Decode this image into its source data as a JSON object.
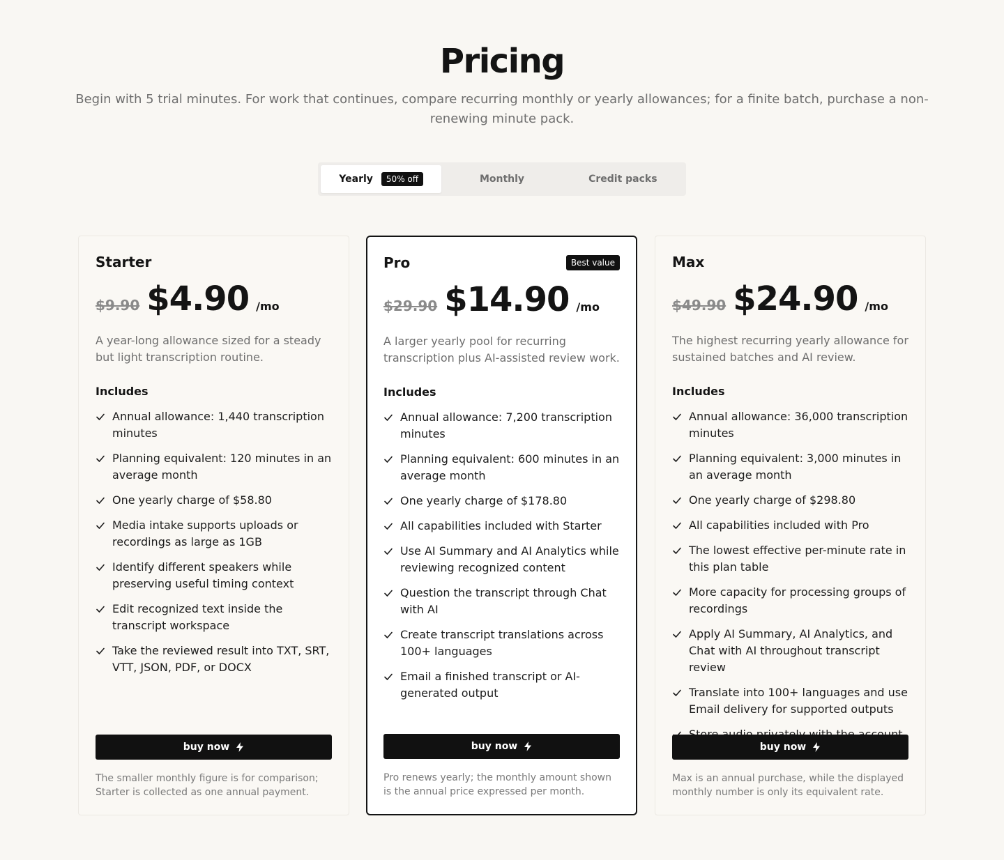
{
  "header": {
    "title": "Pricing",
    "subtitle": "Begin with 5 trial minutes. For work that continues, compare recurring monthly or yearly allowances; for a finite batch, purchase a non-renewing minute pack."
  },
  "billing_toggle": {
    "yearly_label": "Yearly",
    "yearly_badge": "50% off",
    "monthly_label": "Monthly",
    "credit_packs_label": "Credit packs",
    "selected": "Yearly"
  },
  "plans": [
    {
      "name": "Starter",
      "old_price": "$9.90",
      "price": "$4.90",
      "period": "/mo",
      "description": "A year-long allowance sized for a steady but light transcription routine.",
      "includes_label": "Includes",
      "features": [
        "Annual allowance: 1,440 transcription minutes",
        "Planning equivalent: 120 minutes in an average month",
        "One yearly charge of $58.80",
        "Media intake supports uploads or recordings as large as 1GB",
        "Identify different speakers while preserving useful timing context",
        "Edit recognized text inside the transcript workspace",
        "Take the reviewed result into TXT, SRT, VTT, JSON, PDF, or DOCX"
      ],
      "button_label": "buy now",
      "footnote": "The smaller monthly figure is for comparison; Starter is collected as one annual payment."
    },
    {
      "name": "Pro",
      "badge": "Best value",
      "old_price": "$29.90",
      "price": "$14.90",
      "period": "/mo",
      "description": "A larger yearly pool for recurring transcription plus AI-assisted review work.",
      "includes_label": "Includes",
      "features": [
        "Annual allowance: 7,200 transcription minutes",
        "Planning equivalent: 600 minutes in an average month",
        "One yearly charge of $178.80",
        "All capabilities included with Starter",
        "Use AI Summary and AI Analytics while reviewing recognized content",
        "Question the transcript through Chat with AI",
        "Create transcript translations across 100+ languages",
        "Email a finished transcript or AI-generated output"
      ],
      "button_label": "buy now",
      "footnote": "Pro renews yearly; the monthly amount shown is the annual price expressed per month."
    },
    {
      "name": "Max",
      "old_price": "$49.90",
      "price": "$24.90",
      "period": "/mo",
      "description": "The highest recurring yearly allowance for sustained batches and AI review.",
      "includes_label": "Includes",
      "features": [
        "Annual allowance: 36,000 transcription minutes",
        "Planning equivalent: 3,000 minutes in an average month",
        "One yearly charge of $298.80",
        "All capabilities included with Pro",
        "The lowest effective per-minute rate in this plan table",
        "More capacity for processing groups of recordings",
        "Apply AI Summary, AI Analytics, and Chat with AI throughout transcript review",
        "Translate into 100+ languages and use Email delivery for supported outputs",
        "Store audio privately with the account"
      ],
      "button_label": "buy now",
      "footnote": "Max is an annual purchase, while the displayed monthly number is only its equivalent rate."
    }
  ],
  "icons": {
    "feature_check": "check-icon",
    "button_icon": "bolt-icon"
  },
  "colors": {
    "background": "#f9f7f3",
    "accent_dark": "#111111",
    "muted_text": "#6e6e6e"
  }
}
